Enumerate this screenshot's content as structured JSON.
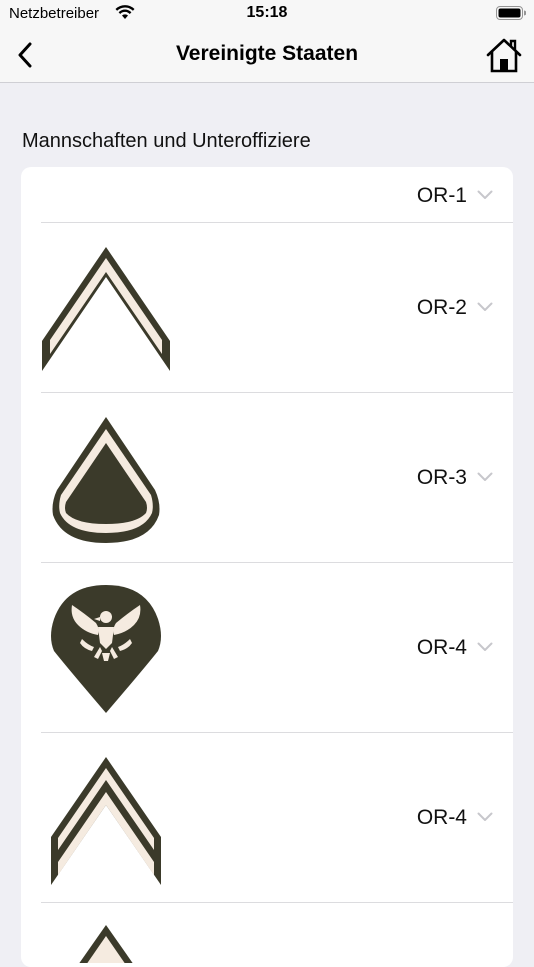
{
  "status": {
    "carrier": "Netzbetreiber",
    "time": "15:18"
  },
  "nav": {
    "title": "Vereinigte Staaten"
  },
  "section": {
    "title": "Mannschaften und Unteroffiziere"
  },
  "ranks": [
    {
      "code": "OR-1",
      "insignia": "none"
    },
    {
      "code": "OR-2",
      "insignia": "single-chevron"
    },
    {
      "code": "OR-3",
      "insignia": "chevron-with-rocker"
    },
    {
      "code": "OR-4",
      "insignia": "specialist-eagle"
    },
    {
      "code": "OR-4",
      "insignia": "double-chevron"
    },
    {
      "code": "",
      "insignia": "chevron-partial"
    }
  ],
  "colors": {
    "insignia_dark": "#3b3a2a",
    "insignia_light": "#f5ebe0",
    "chevron_gray": "#c7c7cc"
  }
}
